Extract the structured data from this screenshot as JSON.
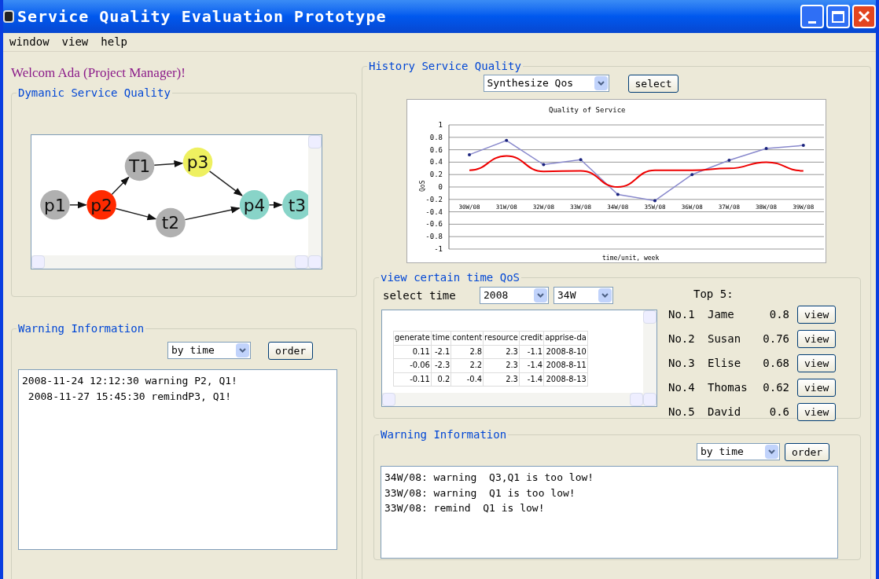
{
  "window": {
    "title": "Service Quality Evaluation Prototype"
  },
  "menu": [
    "window",
    "view",
    "help"
  ],
  "welcome": "Welcom Ada (Project Manager)!",
  "dynamic": {
    "title": "Dymanic Service Quality",
    "nodes": [
      {
        "label": "p1",
        "color": "#b0b0b0"
      },
      {
        "label": "p2",
        "color": "#ff2a00"
      },
      {
        "label": "T1",
        "color": "#b0b0b0"
      },
      {
        "label": "t2",
        "color": "#b0b0b0"
      },
      {
        "label": "p3",
        "color": "#eef060"
      },
      {
        "label": "p4",
        "color": "#88d4c8"
      },
      {
        "label": "t3",
        "color": "#88d4c8"
      }
    ]
  },
  "left_warning": {
    "title": "Warning Information",
    "sort": "by time",
    "button": "order",
    "lines": [
      "2008-11-24 12:12:30 warning P2, Q1!",
      " 2008-11-27 15:45:30 remindP3, Q1!"
    ]
  },
  "history": {
    "title": "History Service Quality",
    "type": "Synthesize Qos",
    "button": "select",
    "chart_data": {
      "type": "line",
      "title": "Quality of Service",
      "xlabel": "time/unit, week",
      "ylabel": "QoS",
      "categories": [
        "30W/08",
        "31W/08",
        "32W/08",
        "33W/08",
        "34W/08",
        "35W/08",
        "36W/08",
        "37W/08",
        "38W/08",
        "39W/08"
      ],
      "series": [
        {
          "color": "#8888cc",
          "values": [
            0.52,
            0.75,
            0.36,
            0.44,
            -0.12,
            -0.22,
            0.2,
            0.43,
            0.62,
            0.67
          ]
        },
        {
          "color": "#ee0000",
          "values": [
            0.27,
            0.5,
            0.25,
            0.26,
            0.0,
            0.27,
            0.27,
            0.3,
            0.4,
            0.26
          ]
        }
      ],
      "ylim": [
        -1,
        1
      ],
      "grid": true,
      "yticks": [
        1,
        0.8,
        0.6,
        0.4,
        0.2,
        0,
        -0.2,
        -0.4,
        -0.6,
        -0.8,
        -1
      ]
    }
  },
  "certain": {
    "title": "view certain time QoS",
    "label": "select time",
    "year": "2008",
    "week": "34W",
    "columns": [
      "generate",
      "time",
      "content",
      "resource",
      "credit",
      "apprise-da"
    ],
    "rows": [
      [
        "0.11",
        "-2.1",
        "2.8",
        "2.3",
        "-1.1",
        "2008-8-10"
      ],
      [
        "-0.06",
        "-2.3",
        "2.2",
        "2.3",
        "-1.4",
        "2008-8-11"
      ],
      [
        "-0.11",
        "0.2",
        "-0.4",
        "2.3",
        "-1.4",
        "2008-8-13"
      ]
    ],
    "top_title": "Top 5:",
    "top": [
      {
        "rank": "No.1",
        "name": "Jame",
        "score": "0.8",
        "button": "view"
      },
      {
        "rank": "No.2",
        "name": "Susan",
        "score": "0.76",
        "button": "view"
      },
      {
        "rank": "No.3",
        "name": "Elise",
        "score": "0.68",
        "button": "view"
      },
      {
        "rank": "No.4",
        "name": "Thomas",
        "score": "0.62",
        "button": "view"
      },
      {
        "rank": "No.5",
        "name": "David",
        "score": "0.6",
        "button": "view"
      }
    ]
  },
  "right_warning": {
    "title": "Warning Information",
    "sort": "by time",
    "button": "order",
    "lines": [
      "34W/08: warning  Q3,Q1 is too low!",
      "33W/08: warning  Q1 is too low!",
      "33W/08: remind  Q1 is low!"
    ]
  }
}
